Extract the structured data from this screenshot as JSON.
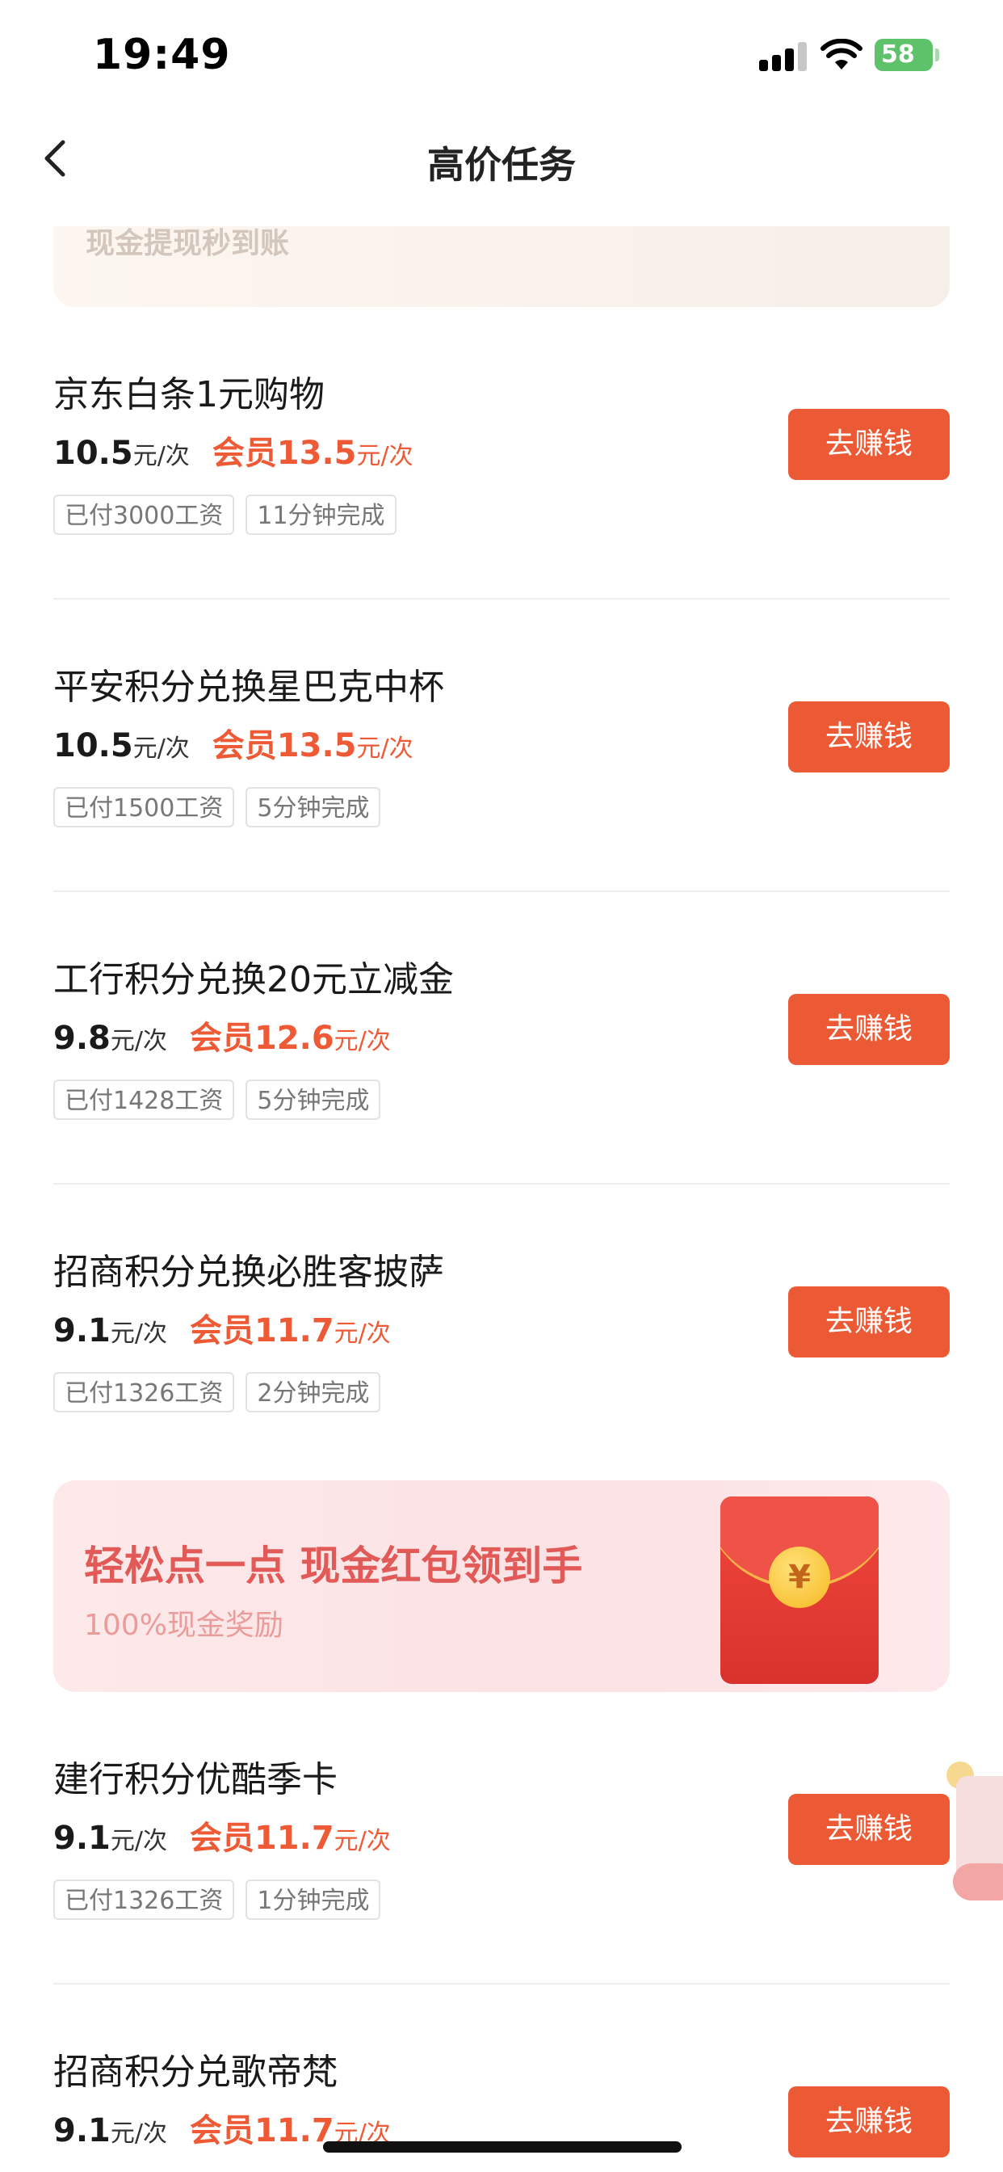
{
  "status_bar": {
    "time": "19:49",
    "battery": "58"
  },
  "nav": {
    "title": "高价任务"
  },
  "top_banner": {
    "text": "现金提现秒到账"
  },
  "tasks": [
    {
      "title": "京东白条1元购物",
      "price": "10.5",
      "unit": "元/次",
      "member_label": "会员13.5",
      "member_unit": "元/次",
      "tags": [
        "已付3000工资",
        "11分钟完成"
      ],
      "button": "去赚钱"
    },
    {
      "title": "平安积分兑换星巴克中杯",
      "price": "10.5",
      "unit": "元/次",
      "member_label": "会员13.5",
      "member_unit": "元/次",
      "tags": [
        "已付1500工资",
        "5分钟完成"
      ],
      "button": "去赚钱"
    },
    {
      "title": "工行积分兑换20元立减金",
      "price": "9.8",
      "unit": "元/次",
      "member_label": "会员12.6",
      "member_unit": "元/次",
      "tags": [
        "已付1428工资",
        "5分钟完成"
      ],
      "button": "去赚钱"
    },
    {
      "title": "招商积分兑换必胜客披萨",
      "price": "9.1",
      "unit": "元/次",
      "member_label": "会员11.7",
      "member_unit": "元/次",
      "tags": [
        "已付1326工资",
        "2分钟完成"
      ],
      "button": "去赚钱"
    },
    {
      "title": "建行积分优酷季卡",
      "price": "9.1",
      "unit": "元/次",
      "member_label": "会员11.7",
      "member_unit": "元/次",
      "tags": [
        "已付1326工资",
        "1分钟完成"
      ],
      "button": "去赚钱"
    },
    {
      "title": "招商积分兑歌帝梵",
      "price": "9.1",
      "unit": "元/次",
      "member_label": "会员11.7",
      "member_unit": "元/次",
      "tags": [],
      "button": "去赚钱"
    }
  ],
  "ad_banner": {
    "title": "轻松点一点 现金红包领到手",
    "subtitle": "100%现金奖励",
    "coin_symbol": "¥"
  },
  "colors": {
    "accent": "#ec5a35",
    "battery": "#5dc26a"
  }
}
